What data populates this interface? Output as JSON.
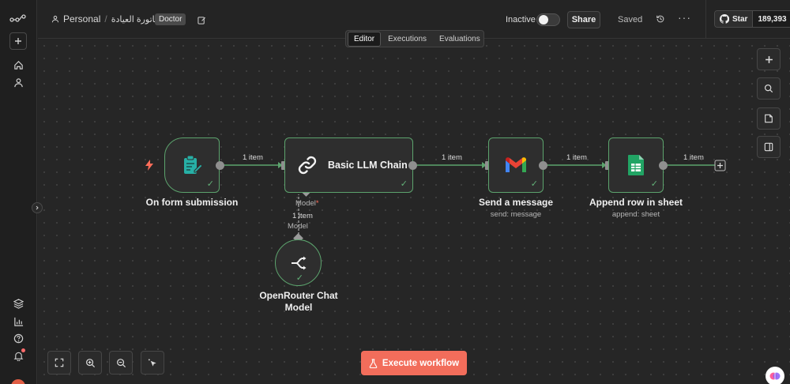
{
  "header": {
    "workspace": "Personal",
    "workflow_name": "فاتورة العيادة",
    "tag": "Doctor",
    "status_label": "Inactive",
    "share_label": "Share",
    "saved_label": "Saved",
    "github_star_label": "Star",
    "github_star_count": "189,393"
  },
  "tabs": [
    {
      "label": "Editor",
      "active": true
    },
    {
      "label": "Executions",
      "active": false
    },
    {
      "label": "Evaluations",
      "active": false
    }
  ],
  "nodes": {
    "form": {
      "label": "On form submission"
    },
    "llm": {
      "label": "Basic LLM Chain",
      "model_port_label": "Model",
      "required_mark": "*"
    },
    "gmail": {
      "label": "Send a message",
      "sub": "send: message"
    },
    "sheets": {
      "label": "Append row in sheet",
      "sub": "append: sheet"
    },
    "openrouter": {
      "label_line1": "OpenRouter Chat",
      "label_line2": "Model",
      "port_label": "Model"
    }
  },
  "connections": {
    "form_llm": "1 item",
    "llm_gmail": "1 item",
    "gmail_sheets": "1 item",
    "sheets_out": "1 item",
    "model_llm": "1 item"
  },
  "execute_label": "Execute workflow",
  "colors": {
    "accent": "#f26d5b",
    "success": "#5ca36d",
    "trigger": "#ff6d5a",
    "form_icon": "#27b0a6",
    "sheets_icon": "#21a464"
  }
}
